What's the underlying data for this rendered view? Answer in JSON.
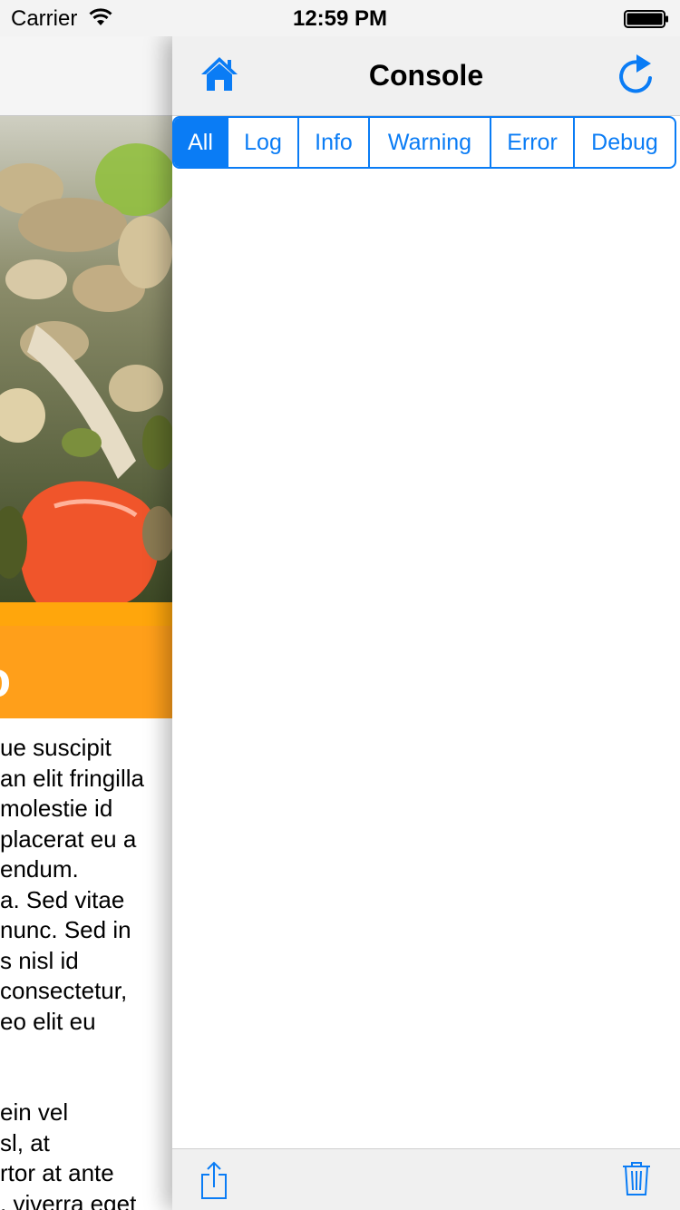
{
  "status_bar": {
    "carrier": "Carrier",
    "time": "12:59 PM"
  },
  "background_article": {
    "banner_partial_text": "o",
    "banner_color": "#ff9f1a",
    "body_lines": [
      "ue suscipit",
      "an elit fringilla",
      "molestie id",
      " placerat eu a",
      "endum.",
      "a. Sed vitae",
      "nunc. Sed in",
      "s nisl id",
      "consectetur,",
      "eo elit eu",
      "",
      "",
      "ein vel",
      "sl, at",
      "rtor at ante",
      ", viverra eget"
    ]
  },
  "console": {
    "title": "Console",
    "accent_color": "#0a7cf5",
    "filter_segments": [
      {
        "label": "All",
        "selected": true
      },
      {
        "label": "Log",
        "selected": false
      },
      {
        "label": "Info",
        "selected": false
      },
      {
        "label": "Warning",
        "selected": false
      },
      {
        "label": "Error",
        "selected": false
      },
      {
        "label": "Debug",
        "selected": false
      }
    ],
    "icons": {
      "nav_left": "home-icon",
      "nav_right": "refresh-icon",
      "toolbar_left": "share-icon",
      "toolbar_right": "trash-icon"
    }
  }
}
